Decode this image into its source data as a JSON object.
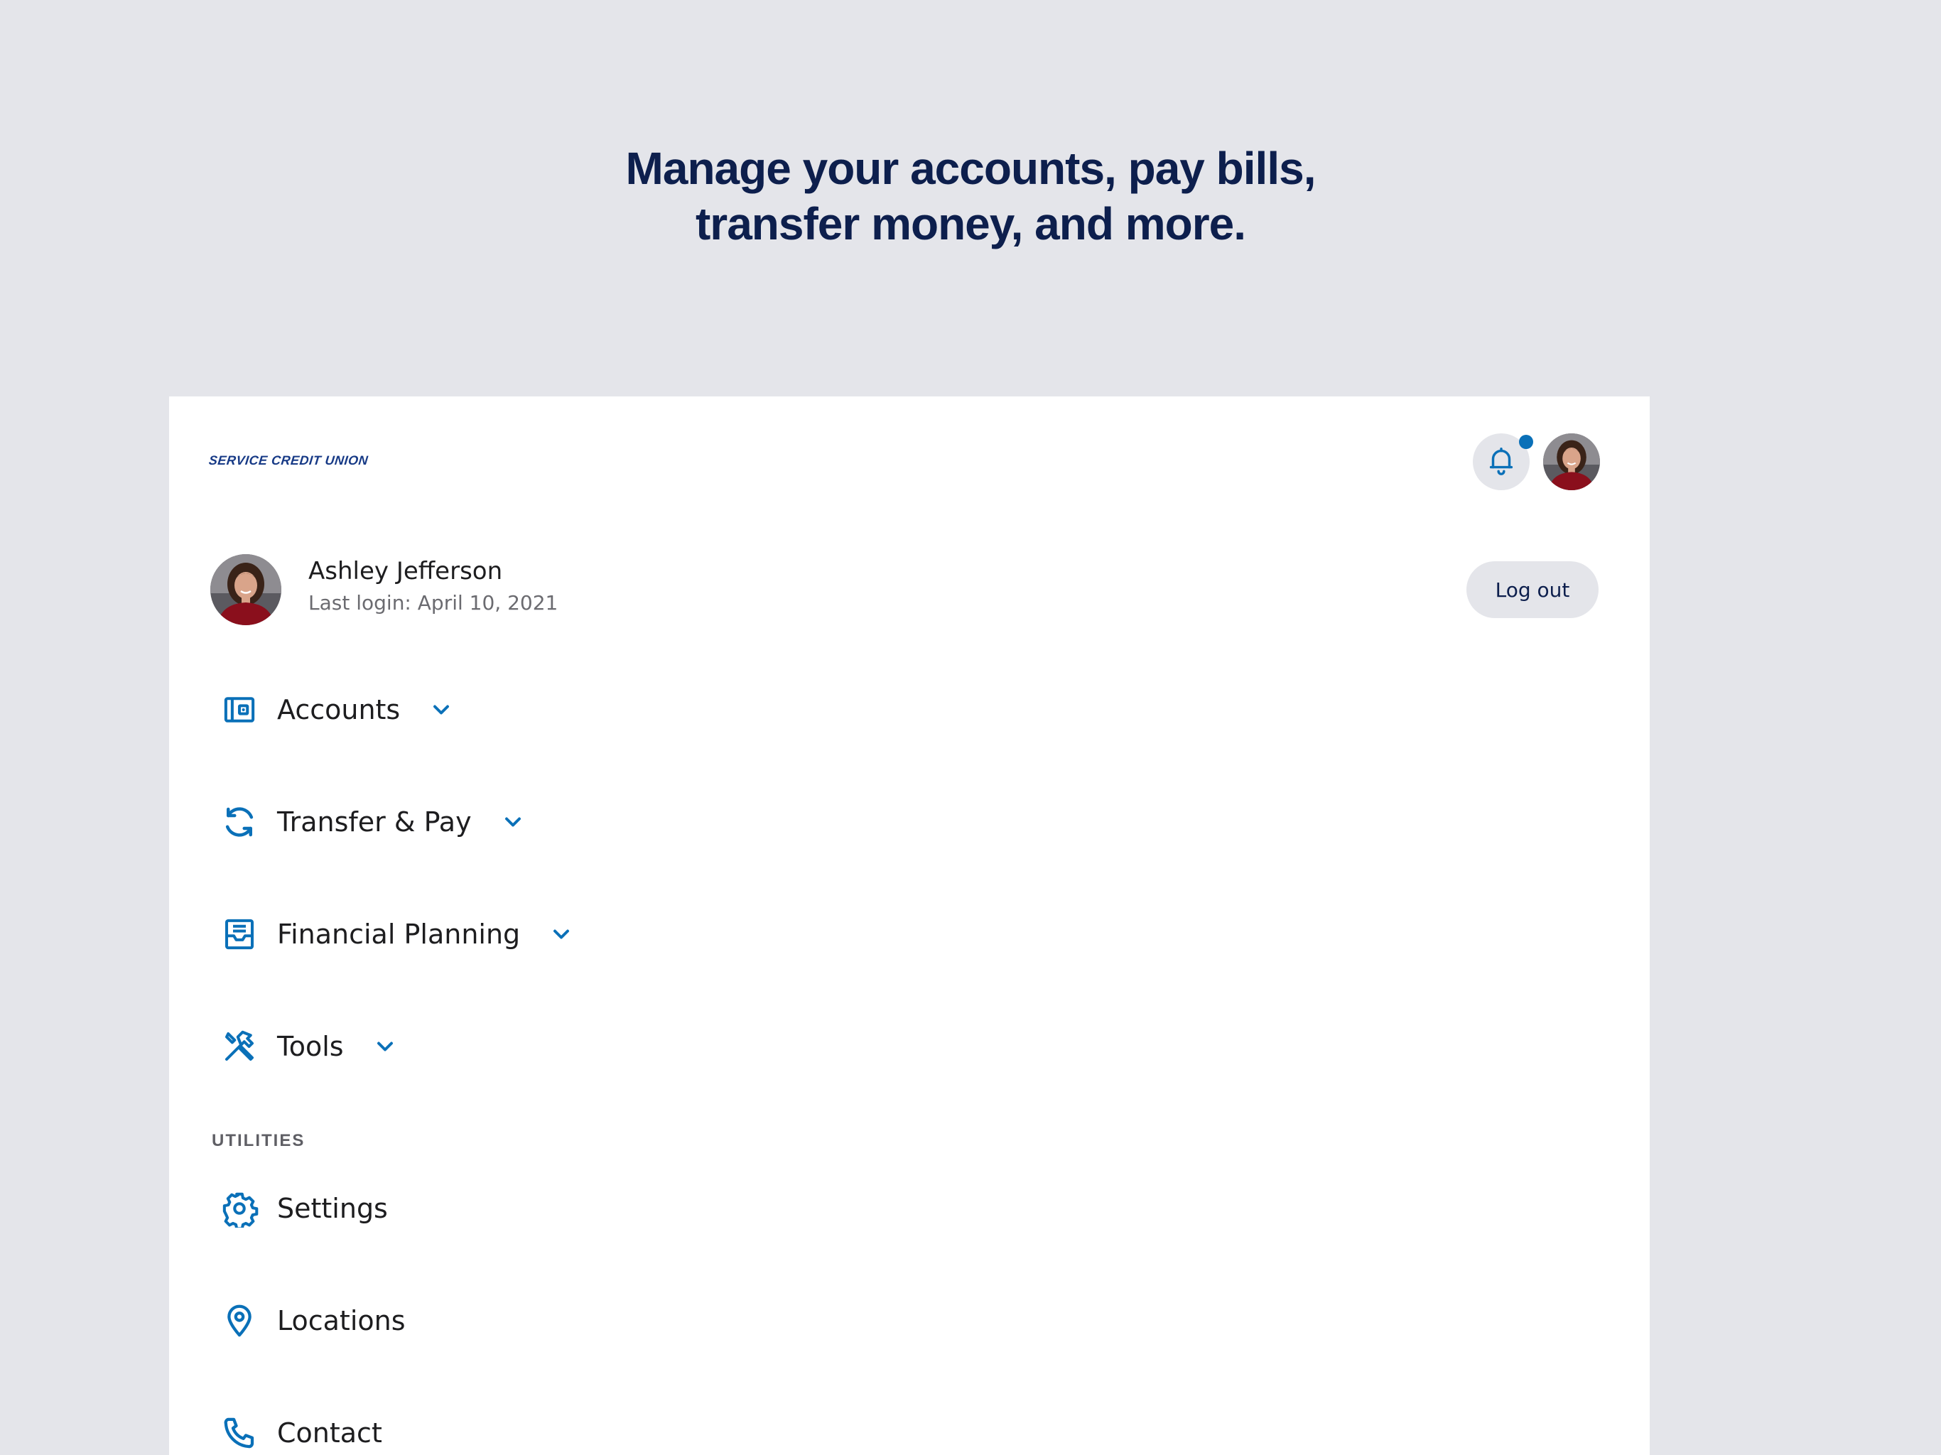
{
  "headline": {
    "line1": "Manage your accounts, pay bills,",
    "line2": "transfer money, and more."
  },
  "brand": {
    "logo_text": "SERVICE CREDIT UNION",
    "accent_color": "#0a70b8",
    "navy_color": "#0d1f4d"
  },
  "header": {
    "notification_icon": "bell-icon",
    "has_unread_notifications": true
  },
  "profile": {
    "name": "Ashley Jefferson",
    "last_login": "Last login: April 10, 2021",
    "logout_label": "Log out"
  },
  "menu": {
    "items": [
      {
        "label": "Accounts",
        "icon": "wallet-icon",
        "expandable": true
      },
      {
        "label": "Transfer & Pay",
        "icon": "refresh-icon",
        "expandable": true
      },
      {
        "label": "Financial Planning",
        "icon": "inbox-icon",
        "expandable": true
      },
      {
        "label": "Tools",
        "icon": "tools-icon",
        "expandable": true
      }
    ]
  },
  "utilities": {
    "section_label": "UTILITIES",
    "items": [
      {
        "label": "Settings",
        "icon": "gear-icon"
      },
      {
        "label": "Locations",
        "icon": "location-pin-icon"
      },
      {
        "label": "Contact",
        "icon": "phone-icon"
      }
    ]
  }
}
